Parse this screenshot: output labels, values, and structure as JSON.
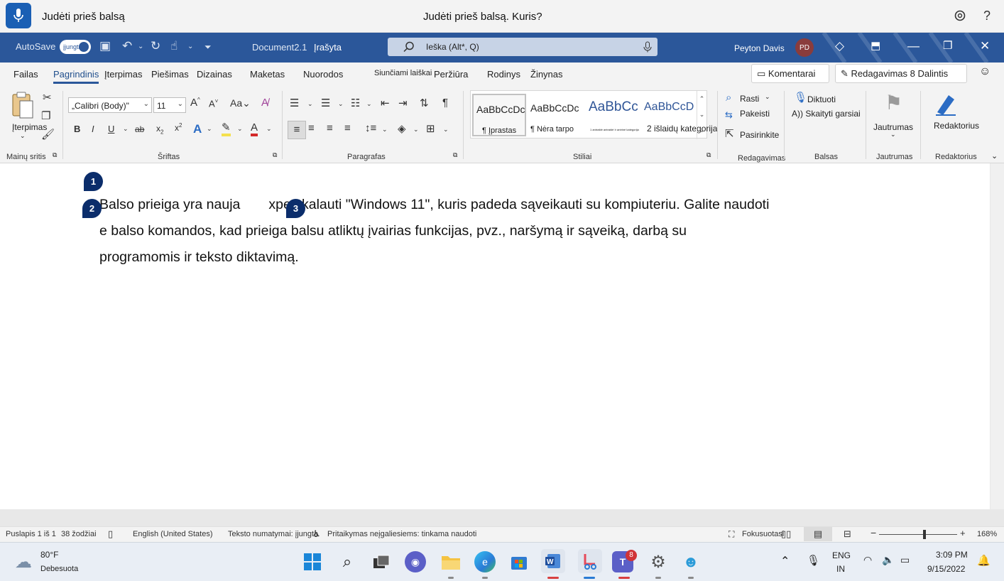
{
  "voice_bar": {
    "status": "Judėti prieš balsą",
    "hint": "Judėti prieš balsą. Kuris?"
  },
  "title_bar": {
    "autosave_label": "AutoSave",
    "autosave_state": "įjungta",
    "document_name": "Document2.1",
    "save_state": "Įrašyta",
    "search_placeholder": "Ieška (Alt*, Q)",
    "user_name": "Peyton Davis",
    "user_initials": "PD"
  },
  "tabs": {
    "items": [
      "Failas",
      "Pagrindinis",
      "Įterpimas",
      "Piešimas",
      "Dizainas",
      "Maketas",
      "Nuorodos",
      "Siunčiami laiškai",
      "Peržiūra",
      "Rodinys",
      "Žinynas"
    ],
    "active": "Pagrindinis",
    "comments_label": "Komentarai",
    "editing_label": "Redagavimas",
    "share_label": "8 Dalintis"
  },
  "ribbon": {
    "clipboard": {
      "paste_label": "Įterpimas",
      "group": "Mainų sritis"
    },
    "font": {
      "font_name": "„Calibri (Body)\"",
      "font_size": "11",
      "group": "Šriftas"
    },
    "paragraph": {
      "group": "Paragrafas"
    },
    "styles": {
      "group": "Stiliai",
      "items": [
        {
          "preview": "AaBbCcDc",
          "name": "¶ Įprastas"
        },
        {
          "preview": "AaBbCcDc",
          "name": "¶ Nėra tarpo"
        },
        {
          "preview": "AaBbCc",
          "name": "1 antraštė antraštė Ir antrinė kategorija"
        },
        {
          "preview": "AaBbCcD",
          "name": "2 išlaidų kategorija"
        }
      ]
    },
    "editing": {
      "find": "Rasti",
      "replace": "Pakeisti",
      "select": "Pasirinkite",
      "group": "Redagavimas"
    },
    "voice": {
      "dictate": "Diktuoti",
      "read_aloud": "A)) Skaityti garsiai",
      "group": "Balsas"
    },
    "sensitivity": {
      "label": "Jautrumas",
      "group": "Jautrumas"
    },
    "editor": {
      "label": "Redaktorius",
      "group": "Redaktorius"
    }
  },
  "document": {
    "line1_a": "Balso prieiga yra nauja",
    "line1_mid": "xp",
    "line1_b": "e skalauti \"Windows 11\", kuris padeda sąveikauti su kompiuteriu. Galite naudoti",
    "line2": "e balso komandos, kad prieiga balsu atliktų įvairias funkcijas, pvz., naršymą ir sąveiką, darbą su",
    "line3": "programomis ir teksto diktavimą.",
    "badges": [
      "1",
      "2",
      "3"
    ]
  },
  "status_bar": {
    "page": "Puslapis 1 iš 1",
    "words": "38 žodžiai",
    "language": "English (United States)",
    "predictions": "Teksto numatymai: įjungta",
    "accessibility": "Pritaikymas neįgaliesiems: tinkama naudoti",
    "focus": "Fokusuotasi",
    "zoom": "168%"
  },
  "taskbar": {
    "weather_temp": "80°F",
    "weather_desc": "Debesuota",
    "teams_badge": "8",
    "lang_top": "ENG",
    "lang_bottom": "IN",
    "time": "3:09 PM",
    "date": "9/15/2022"
  },
  "colors": {
    "word_blue": "#2b579a",
    "badge_navy": "#0b2d6b",
    "mic_blue": "#1a5fb4"
  }
}
